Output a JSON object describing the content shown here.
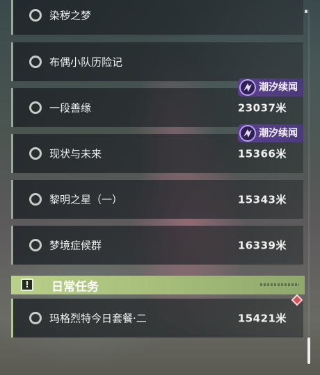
{
  "quests": [
    {
      "name": "染秽之梦",
      "distance": "",
      "badge": ""
    },
    {
      "name": "布偶小队历险记",
      "distance": "",
      "badge": ""
    },
    {
      "name": "一段善缘",
      "distance": "23037米",
      "badge": "潮汐续闻"
    },
    {
      "name": "现状与未来",
      "distance": "15366米",
      "badge": "潮汐续闻"
    },
    {
      "name": "黎明之星（一）",
      "distance": "15343米",
      "badge": ""
    },
    {
      "name": "梦境症候群",
      "distance": "16339米",
      "badge": ""
    }
  ],
  "daily_section": {
    "title": "日常任务",
    "icon": "exclamation-icon",
    "quests": [
      {
        "name": "玛格烈特今日套餐·二",
        "distance": "15421米",
        "badge": ""
      }
    ]
  },
  "colors": {
    "badge_purple": "#5b3f8e",
    "section_green": "#b9cf8a",
    "alert_red": "#d9505a"
  }
}
